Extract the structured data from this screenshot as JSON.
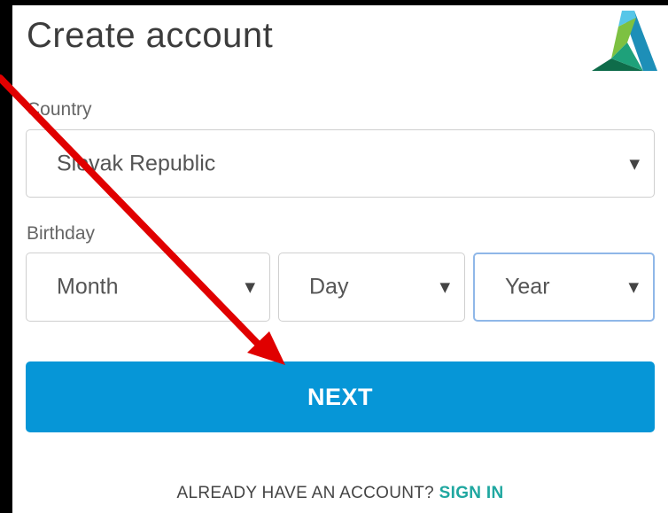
{
  "header": {
    "title": "Create account"
  },
  "form": {
    "country": {
      "label": "Country",
      "value": "Slovak Republic"
    },
    "birthday": {
      "label": "Birthday",
      "month": "Month",
      "day": "Day",
      "year": "Year"
    },
    "next_label": "NEXT"
  },
  "footer": {
    "prompt": "ALREADY HAVE AN ACCOUNT?",
    "link": "SIGN IN"
  },
  "icons": {
    "logo": "autodesk-logo-icon",
    "caret": "chevron-down-icon",
    "annotation": "red-arrow-annotation"
  },
  "colors": {
    "accent": "#0696d7",
    "link": "#1fa7a0",
    "focus_border": "#8fb7e8",
    "annotation": "#e00000"
  }
}
